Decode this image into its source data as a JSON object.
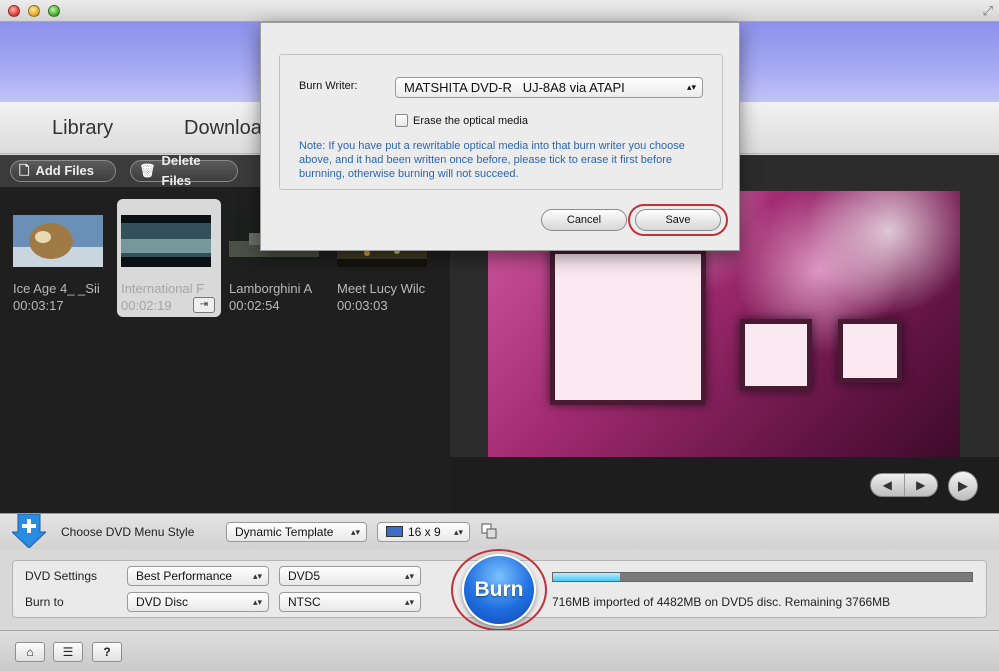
{
  "tabs": {
    "library": "Library",
    "download": "Downloa"
  },
  "toolbar": {
    "add_files": "Add Files",
    "delete_files": "Delete Files"
  },
  "clips": [
    {
      "name": "Ice Age 4_ _Sii",
      "duration": "00:03:17"
    },
    {
      "name": "International F",
      "duration": "00:02:19"
    },
    {
      "name": "Lamborghini A",
      "duration": "00:02:54"
    },
    {
      "name": "Meet Lucy Wilc",
      "duration": "00:03:03"
    }
  ],
  "menu_style": {
    "label": "Choose DVD Menu Style",
    "template": "Dynamic Template",
    "ratio": "16 x 9"
  },
  "settings": {
    "dvd_settings_label": "DVD Settings",
    "burn_to_label": "Burn to",
    "quality": "Best Performance",
    "disc_type": "DVD5",
    "target": "DVD Disc",
    "tv_standard": "NTSC"
  },
  "burn": {
    "button": "Burn",
    "status": "716MB imported of 4482MB on DVD5 disc. Remaining 3766MB",
    "progress_fraction": 0.16
  },
  "dialog": {
    "burn_writer_label": "Burn Writer:",
    "burn_writer_value": "MATSHITA DVD-R   UJ-8A8 via ATAPI",
    "erase_label": "Erase the optical media",
    "note": "Note: If you have put a rewritable optical media into that burn writer you choose above, and it had been written once before, please tick to erase it first before burnning, otherwise burning will not succeed.",
    "cancel": "Cancel",
    "save": "Save"
  },
  "bottom": {
    "help": "?"
  },
  "colors": {
    "accent_highlight": "#c1323a",
    "note_text": "#2b67b3",
    "banner": "#9ea1f0"
  }
}
